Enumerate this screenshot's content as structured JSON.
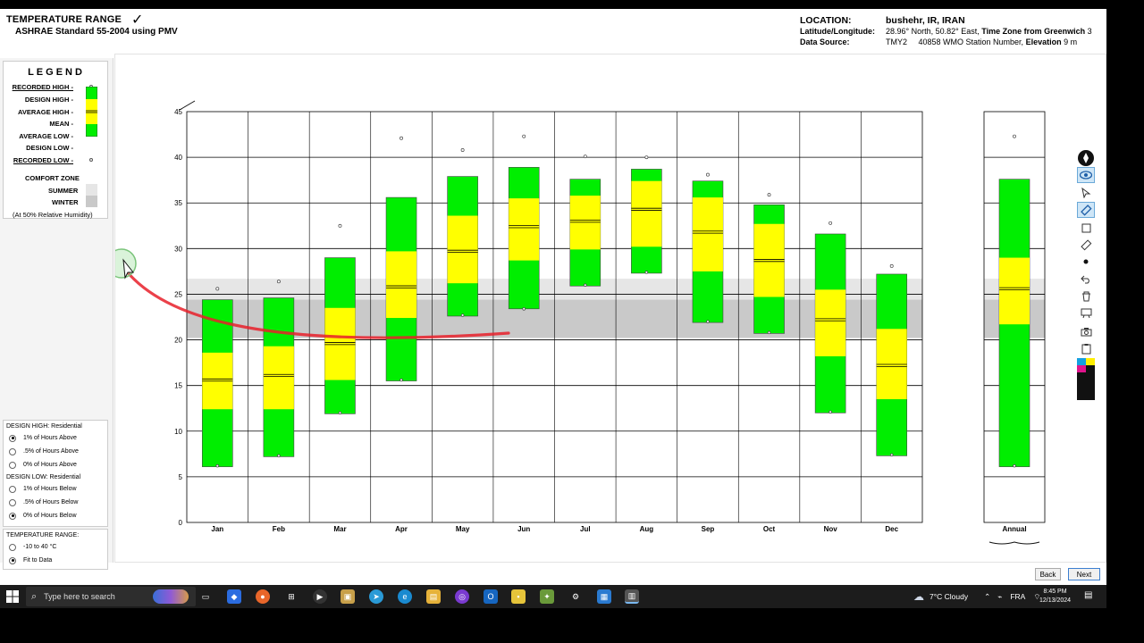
{
  "header": {
    "title": "TEMPERATURE RANGE",
    "subtitle": "ASHRAE Standard 55-2004 using PMV",
    "location_label": "LOCATION:",
    "location_value": "bushehr, IR, IRAN",
    "latlon_label": "Latitude/Longitude:",
    "latlon_value": "28.96° North, 50.82° East,",
    "timezone_label": "Time Zone from Greenwich",
    "timezone_value": "3",
    "source_label": "Data Source:",
    "source_value": "TMY2     40858 WMO Station Number,",
    "elevation_label": "Elevation",
    "elevation_value": "9 m"
  },
  "legend": {
    "title": "LEGEND",
    "recorded_high": "RECORDED HIGH -",
    "design_high": "DESIGN HIGH -",
    "average_high": "AVERAGE HIGH -",
    "mean": "MEAN -",
    "average_low": "AVERAGE LOW -",
    "design_low": "DESIGN LOW -",
    "recorded_low": "RECORDED LOW -",
    "comfort_zone": "COMFORT ZONE",
    "summer": "SUMMER",
    "winter": "WINTER",
    "humidity_note": "(At 50% Relative Humidity)"
  },
  "options": {
    "design_high": {
      "title": "DESIGN HIGH:  Residential",
      "items": [
        {
          "label": "1% of Hours Above",
          "selected": true
        },
        {
          "label": ".5% of Hours Above",
          "selected": false
        },
        {
          "label": "0% of Hours Above",
          "selected": false
        }
      ]
    },
    "design_low": {
      "title": "DESIGN LOW:  Residential",
      "items": [
        {
          "label": "1% of Hours Below",
          "selected": false
        },
        {
          "label": ".5% of Hours Below",
          "selected": false
        },
        {
          "label": "0% of Hours Below",
          "selected": true
        }
      ]
    },
    "temp_range": {
      "title": "TEMPERATURE RANGE:",
      "items": [
        {
          "label": "-10 to 40 °C",
          "selected": false
        },
        {
          "label": "Fit to Data",
          "selected": true
        }
      ]
    }
  },
  "chart_data": {
    "type": "box",
    "categories": [
      "Jan",
      "Feb",
      "Mar",
      "Apr",
      "May",
      "Jun",
      "Jul",
      "Aug",
      "Sep",
      "Oct",
      "Nov",
      "Dec"
    ],
    "annual_label": "Annual",
    "y_ticks": [
      0,
      5,
      10,
      15,
      20,
      25,
      30,
      35,
      40,
      45
    ],
    "ylim": [
      0,
      45
    ],
    "recorded_high": [
      25.3,
      26.1,
      32.2,
      41.8,
      40.5,
      42.0,
      39.8,
      39.7,
      37.8,
      35.6,
      32.5,
      27.8
    ],
    "design_high": [
      24.4,
      24.6,
      29.0,
      35.6,
      37.9,
      38.9,
      37.6,
      38.7,
      37.4,
      34.8,
      31.6,
      27.2
    ],
    "average_high": [
      18.6,
      19.3,
      23.5,
      29.7,
      33.6,
      35.5,
      35.8,
      37.4,
      35.6,
      32.7,
      25.5,
      21.2
    ],
    "mean": [
      15.6,
      16.1,
      19.6,
      25.8,
      29.7,
      32.4,
      33.0,
      34.3,
      31.8,
      28.7,
      22.2,
      17.2
    ],
    "average_low": [
      12.4,
      12.4,
      15.6,
      22.4,
      26.2,
      28.7,
      29.9,
      30.2,
      27.5,
      24.7,
      18.2,
      13.5
    ],
    "design_low": [
      6.1,
      7.2,
      11.9,
      15.5,
      22.6,
      23.4,
      25.9,
      27.3,
      21.9,
      20.7,
      12.0,
      7.3
    ],
    "recorded_low": [
      6.1,
      7.2,
      11.9,
      15.5,
      22.6,
      23.3,
      25.9,
      27.3,
      21.9,
      20.7,
      12.0,
      7.3
    ],
    "annual": {
      "recorded_high": 42.0,
      "design_high": 37.6,
      "average_high": 29.0,
      "mean": 25.6,
      "average_low": 21.7,
      "design_low": 6.1,
      "recorded_low": 6.1
    },
    "comfort_zone": {
      "summer": [
        20.2,
        26.7
      ],
      "winter": [
        20.2,
        24.4
      ]
    },
    "colors": {
      "design": "#00ee00",
      "average": "#ffff00",
      "summer": "#e6e6e6",
      "winter": "#c9c9c9",
      "annotation": "#e8202a"
    }
  },
  "toolbar": {
    "icons": [
      "pen-logo-icon",
      "eye-icon",
      "pointer-icon",
      "highlighter-icon",
      "square-icon",
      "eraser-icon",
      "dot-icon",
      "undo-icon",
      "trash-icon",
      "projector-icon",
      "camera-icon",
      "clipboard-icon",
      "color-palette-icon"
    ]
  },
  "nav": {
    "back": "Back",
    "next": "Next"
  },
  "taskbar": {
    "search_placeholder": "Type here to search",
    "weather": "7°C  Cloudy",
    "language": "FRA",
    "time": "8:45 PM",
    "date": "12/13/2024"
  }
}
